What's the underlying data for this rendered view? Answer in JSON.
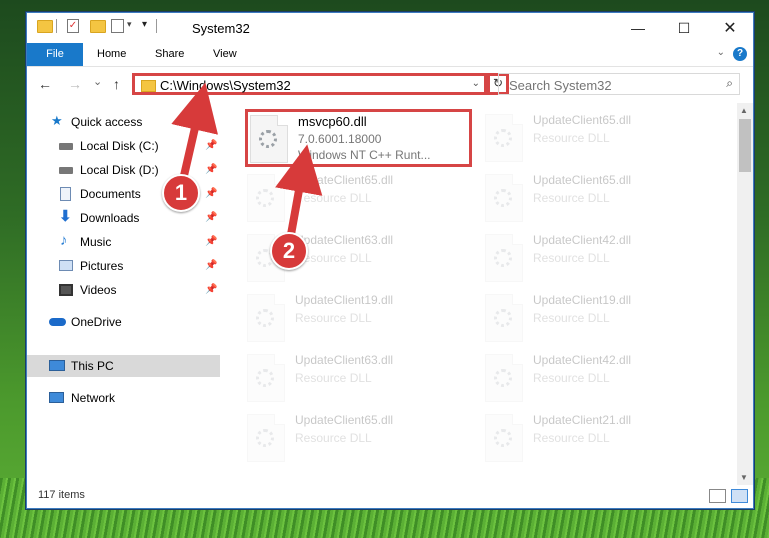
{
  "window": {
    "title": "System32"
  },
  "ribbon": {
    "tabs": [
      "File",
      "Home",
      "Share",
      "View"
    ],
    "help": "?"
  },
  "nav": {
    "back": "←",
    "forward": "→",
    "recent": "⌄",
    "up": "↑"
  },
  "address": {
    "path": "C:\\Windows\\System32",
    "refresh": "↻"
  },
  "search": {
    "placeholder": "Search System32"
  },
  "sidebar": {
    "items": [
      {
        "label": "Quick access",
        "icon": "star-icon"
      },
      {
        "label": "Local Disk (C:)",
        "icon": "drive-icon"
      },
      {
        "label": "Local Disk (D:)",
        "icon": "drive-icon"
      },
      {
        "label": "Documents",
        "icon": "documents-icon"
      },
      {
        "label": "Downloads",
        "icon": "download-icon"
      },
      {
        "label": "Music",
        "icon": "music-icon"
      },
      {
        "label": "Pictures",
        "icon": "pictures-icon"
      },
      {
        "label": "Videos",
        "icon": "videos-icon"
      },
      {
        "label": "OneDrive",
        "icon": "cloud-icon"
      },
      {
        "label": "This PC",
        "icon": "computer-icon",
        "selected": true
      },
      {
        "label": "Network",
        "icon": "network-icon"
      }
    ]
  },
  "files": [
    {
      "name": "msvcp60.dll",
      "line2": "7.0.6001.18000",
      "line3": "Windows NT C++ Runt...",
      "highlight": true
    },
    {
      "name": "UpdateClient65.dll",
      "line2": "Resource DLL"
    },
    {
      "name": "UpdateClient65.dll",
      "line2": "Resource DLL"
    },
    {
      "name": "UpdateClient65.dll",
      "line2": "Resource DLL"
    },
    {
      "name": "UpdateClient63.dll",
      "line2": "Resource DLL"
    },
    {
      "name": "UpdateClient42.dll",
      "line2": "Resource DLL"
    },
    {
      "name": "UpdateClient19.dll",
      "line2": "Resource DLL"
    },
    {
      "name": "UpdateClient19.dll",
      "line2": "Resource DLL"
    },
    {
      "name": "UpdateClient63.dll",
      "line2": "Resource DLL"
    },
    {
      "name": "UpdateClient42.dll",
      "line2": "Resource DLL"
    },
    {
      "name": "UpdateClient65.dll",
      "line2": "Resource DLL"
    },
    {
      "name": "UpdateClient21.dll",
      "line2": "Resource DLL"
    }
  ],
  "status": {
    "count": "117 items"
  },
  "callouts": {
    "one": "1",
    "two": "2"
  },
  "colors": {
    "accent": "#1979ca",
    "highlight": "#d64545"
  }
}
